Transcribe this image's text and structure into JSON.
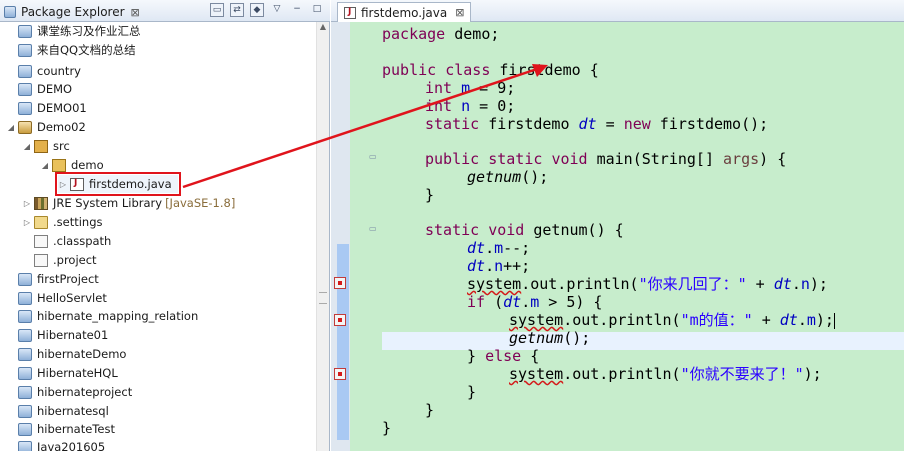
{
  "package_explorer": {
    "tab_label": "Package Explorer",
    "close_glyph": "⊠",
    "items": [
      {
        "label": "课堂练习及作业汇总",
        "suffix": "",
        "kind": "project"
      },
      {
        "label": "来自QQ文档的总结",
        "suffix": "",
        "kind": "project"
      },
      {
        "label": "country",
        "suffix": "",
        "kind": "project"
      },
      {
        "label": "DEMO",
        "suffix": "",
        "kind": "project"
      },
      {
        "label": "DEMO01",
        "suffix": "",
        "kind": "project"
      },
      {
        "label": "Demo02",
        "suffix": "",
        "kind": "project-open"
      },
      {
        "label": "src",
        "suffix": "",
        "kind": "src"
      },
      {
        "label": "demo",
        "suffix": "",
        "kind": "pkg"
      },
      {
        "label": "firstdemo.java",
        "suffix": "",
        "kind": "java"
      },
      {
        "label": "JRE System Library",
        "suffix": "[JavaSE-1.8]",
        "kind": "lib"
      },
      {
        "label": ".settings",
        "suffix": "",
        "kind": "folder"
      },
      {
        "label": ".classpath",
        "suffix": "",
        "kind": "file"
      },
      {
        "label": ".project",
        "suffix": "",
        "kind": "file"
      },
      {
        "label": "firstProject",
        "suffix": "",
        "kind": "project"
      },
      {
        "label": "HelloServlet",
        "suffix": "",
        "kind": "project"
      },
      {
        "label": "hibernate_mapping_relation",
        "suffix": "",
        "kind": "project"
      },
      {
        "label": "Hibernate01",
        "suffix": "",
        "kind": "project"
      },
      {
        "label": "hibernateDemo",
        "suffix": "",
        "kind": "project"
      },
      {
        "label": "HibernateHQL",
        "suffix": "",
        "kind": "project"
      },
      {
        "label": "hibernateproject",
        "suffix": "",
        "kind": "project"
      },
      {
        "label": "hibernatesql",
        "suffix": "",
        "kind": "project"
      },
      {
        "label": "hibernateTest",
        "suffix": "",
        "kind": "project"
      },
      {
        "label": "Java201605",
        "suffix": "",
        "kind": "project"
      }
    ]
  },
  "editor": {
    "tab_label": "firstdemo.java",
    "close_glyph": "⊠",
    "code": {
      "l1": [
        "package",
        " demo;"
      ],
      "l2": [
        "public",
        " ",
        "class",
        " firstdemo {"
      ],
      "l3": [
        "int",
        " ",
        "m",
        " = 9;"
      ],
      "l4": [
        "int",
        " ",
        "n",
        " = 0;"
      ],
      "l5": [
        "static",
        " firstdemo ",
        "dt",
        " = ",
        "new",
        " firstdemo();"
      ],
      "l6": [
        "public",
        " ",
        "static",
        " ",
        "void",
        " main(String[] ",
        "args",
        ") {"
      ],
      "l7": [
        "getnum",
        "();"
      ],
      "l8": [
        "}"
      ],
      "l9": [
        "static",
        " ",
        "void",
        " getnum() {"
      ],
      "l10": [
        "dt",
        ".",
        "m",
        "--;"
      ],
      "l11": [
        "dt",
        ".",
        "n",
        "++;"
      ],
      "l12": [
        "system",
        ".out.println(",
        "\"你来几回了：\"",
        " + ",
        "dt",
        ".",
        "n",
        ");"
      ],
      "l13": [
        "if",
        " (",
        "dt",
        ".",
        "m",
        " > 5) {"
      ],
      "l14": [
        "system",
        ".out.println(",
        "\"m的值：\"",
        " + ",
        "dt",
        ".",
        "m",
        ");"
      ],
      "l15": [
        "getnum",
        "();"
      ],
      "l16": [
        "}",
        " ",
        "else",
        " {"
      ],
      "l17": [
        "system",
        ".out.println(",
        "\"你就不要来了！\"",
        ");"
      ],
      "l18": [
        "}"
      ],
      "l19": [
        "}"
      ],
      "l20": [
        "}"
      ]
    }
  },
  "colors": {
    "editor_bg": "#c7edcc",
    "keyword": "#7f0055",
    "field": "#0000c0",
    "string": "#2a00ff",
    "annotation_red": "#e0141c"
  }
}
